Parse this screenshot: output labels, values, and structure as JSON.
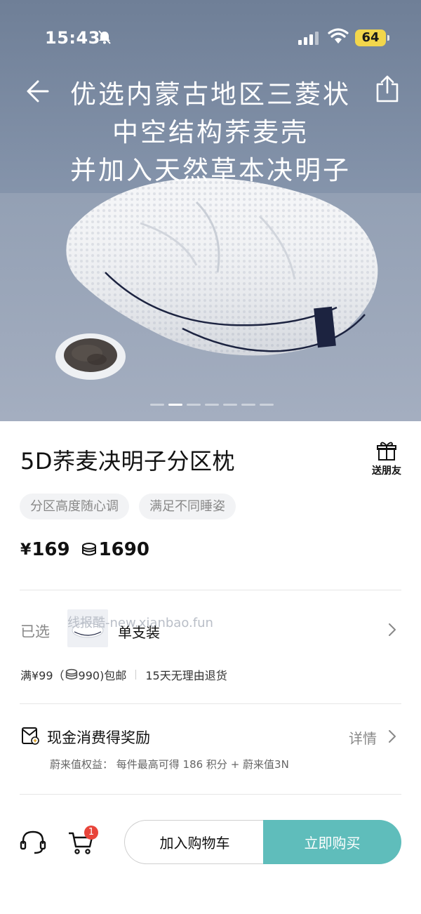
{
  "status_bar": {
    "time": "15:43",
    "battery": "64"
  },
  "hero": {
    "headline": [
      "优选内蒙古地区三菱状",
      "中空结构荞麦壳",
      "并加入天然草本决明子"
    ],
    "carousel": {
      "total": 7,
      "active_index": 1
    }
  },
  "product": {
    "title": "5D荞麦决明子分区枕",
    "gift_label": "送朋友",
    "tags": [
      "分区高度随心调",
      "满足不同睡姿"
    ],
    "price_symbol": "¥",
    "price": "169",
    "points": "1690"
  },
  "selection": {
    "label": "已选",
    "sku_name": "单支装",
    "watermark": "线报酷-new.xianbao.fun"
  },
  "shipping": {
    "free_shipping_pre": "满¥99（",
    "free_shipping_points": "990)包邮",
    "return_policy": "15天无理由退货"
  },
  "reward": {
    "title": "现金消费得奖励",
    "details_label": "详情",
    "description": "蔚来值权益：  每件最高可得 186 积分 + 蔚来值3N"
  },
  "bottom_bar": {
    "cart_count": "1",
    "add_to_cart": "加入购物车",
    "buy_now": "立即购买"
  },
  "colors": {
    "accent": "#5fbdbb",
    "badge": "#e8443a",
    "battery": "#f2d64b"
  }
}
